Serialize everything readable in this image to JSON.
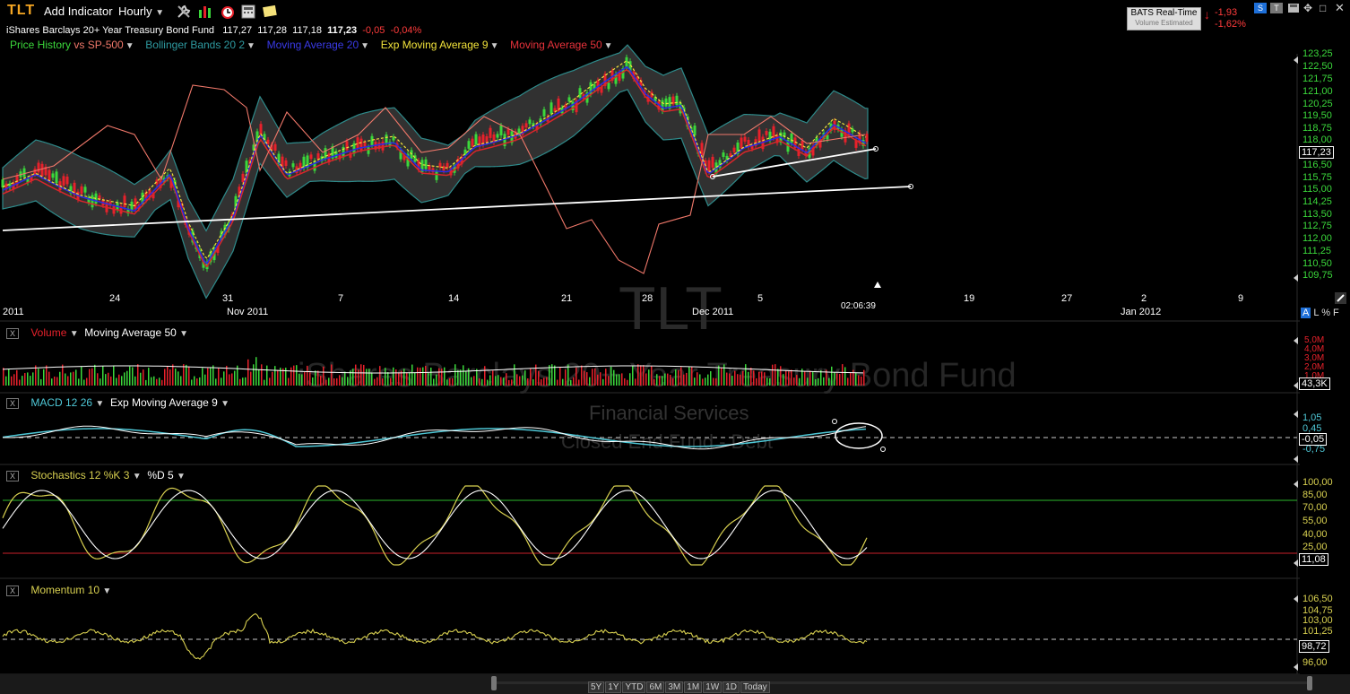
{
  "toolbar": {
    "ticker": "TLT",
    "add_indicator": "Add Indicator",
    "interval": "Hourly",
    "tools": [
      "wrench-icon",
      "bar-chart-icon",
      "alarm-clock-icon",
      "calculator-icon",
      "note-icon"
    ]
  },
  "quote": {
    "name": "iShares Barclays 20+ Year Treasury Bond Fund",
    "open": "117,27",
    "high": "117,28",
    "low": "117,18",
    "last": "117,23",
    "change": "-0,05",
    "change_pct": "-0,04%"
  },
  "feed": {
    "label": "BATS Real-Time",
    "sub": "Volume Estimated",
    "change": "-1,93",
    "change_pct": "-1,62%"
  },
  "legend": {
    "price_history": "Price History",
    "vs": "vs SP-500",
    "bollinger": "Bollinger Bands 20 2",
    "ma20": "Moving Average 20",
    "ema9": "Exp Moving Average 9",
    "ma50": "Moving Average 50"
  },
  "price_axis": [
    "123,25",
    "122,50",
    "121,75",
    "121,00",
    "120,25",
    "119,50",
    "118,75",
    "118,00",
    "116,50",
    "115,75",
    "115,00",
    "114,25",
    "113,50",
    "112,75",
    "112,00",
    "111,25",
    "110,50",
    "109,75"
  ],
  "current_price": "117,23",
  "time_axis": {
    "labels": [
      "24",
      "31",
      "7",
      "14",
      "21",
      "28",
      "5",
      "19",
      "27",
      "2",
      "9"
    ],
    "months": [
      "2011",
      "Nov 2011",
      "Dec 2011",
      "Jan 2012"
    ],
    "cursor_time": "02:06:39",
    "scale_opts": [
      "A",
      "L",
      "%",
      "F"
    ]
  },
  "volume": {
    "title": "Volume",
    "ma": "Moving Average 50",
    "axis": [
      "5,0M",
      "4,0M",
      "3,0M",
      "2,0M",
      "1,0M"
    ],
    "current": "43,3K"
  },
  "macd": {
    "title": "MACD 12 26",
    "ema": "Exp Moving Average 9",
    "axis": [
      "1,05",
      "0,45",
      "-0,75"
    ],
    "current": "-0,05"
  },
  "stochastics": {
    "title": "Stochastics 12 %K 3",
    "d": "%D 5",
    "axis": [
      "100,00",
      "85,00",
      "70,00",
      "55,00",
      "40,00",
      "25,00"
    ],
    "current": "11,08"
  },
  "momentum": {
    "title": "Momentum 10",
    "axis": [
      "106,50",
      "104,75",
      "103,00",
      "101,25",
      "96,00"
    ],
    "current": "98,72"
  },
  "watermark": {
    "ticker": "TLT",
    "name": "iShares Barclays 20+ Year Treasury Bond Fund",
    "sector": "Financial Services",
    "category": "Closed End Fund - Debt"
  },
  "ranges": [
    "5Y",
    "1Y",
    "YTD",
    "6M",
    "3M",
    "1M",
    "1W",
    "1D",
    "Today"
  ],
  "colors": {
    "up": "#3bd83b",
    "down": "#e8212b",
    "bollinger": "#2e8a8a",
    "ma20": "#2a2ae8",
    "ema9": "#f2e33b",
    "ma50": "#d8262b",
    "sp500": "#f0786a",
    "macd": "#4ec7d6",
    "stoch": "#d8d050"
  }
}
